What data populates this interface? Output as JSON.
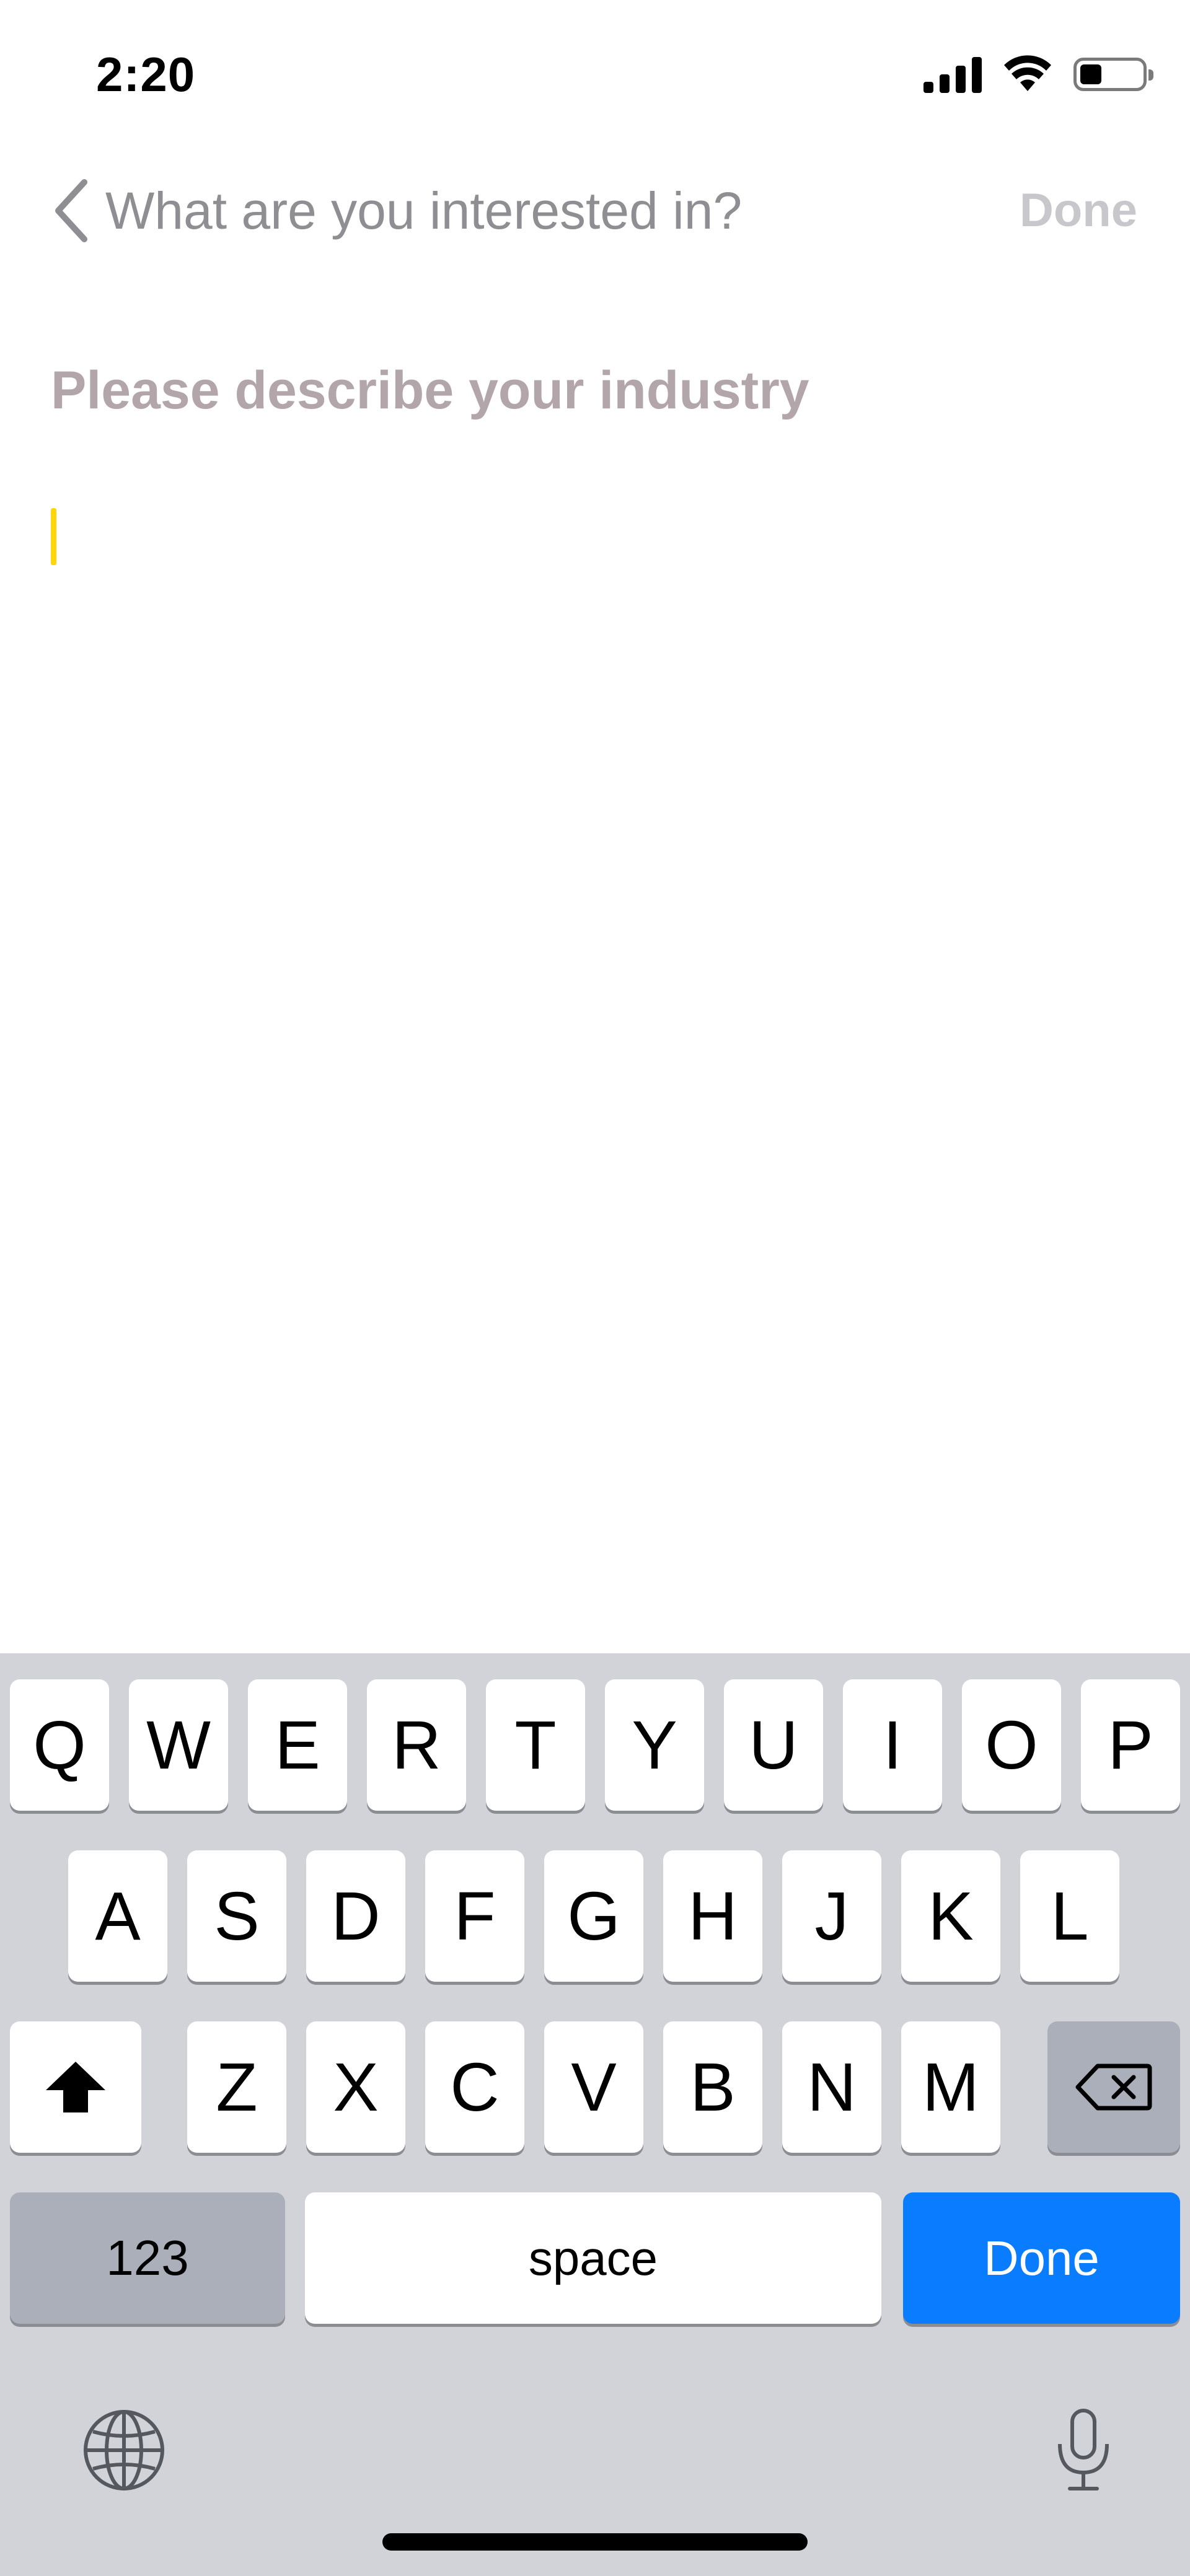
{
  "status_bar": {
    "time": "2:20",
    "battery_level": 0.35
  },
  "nav": {
    "title": "What are you interested in?",
    "done_label": "Done"
  },
  "content": {
    "heading": "Please describe your industry",
    "input_value": ""
  },
  "keyboard": {
    "row1": [
      "Q",
      "W",
      "E",
      "R",
      "T",
      "Y",
      "U",
      "I",
      "O",
      "P"
    ],
    "row2": [
      "A",
      "S",
      "D",
      "F",
      "G",
      "H",
      "J",
      "K",
      "L"
    ],
    "row3": [
      "Z",
      "X",
      "C",
      "V",
      "B",
      "N",
      "M"
    ],
    "numbers_label": "123",
    "space_label": "space",
    "done_label": "Done"
  },
  "colors": {
    "accent": "#0a7cff",
    "caret": "#ffd60a",
    "keyboard_bg": "#d1d3d9"
  }
}
